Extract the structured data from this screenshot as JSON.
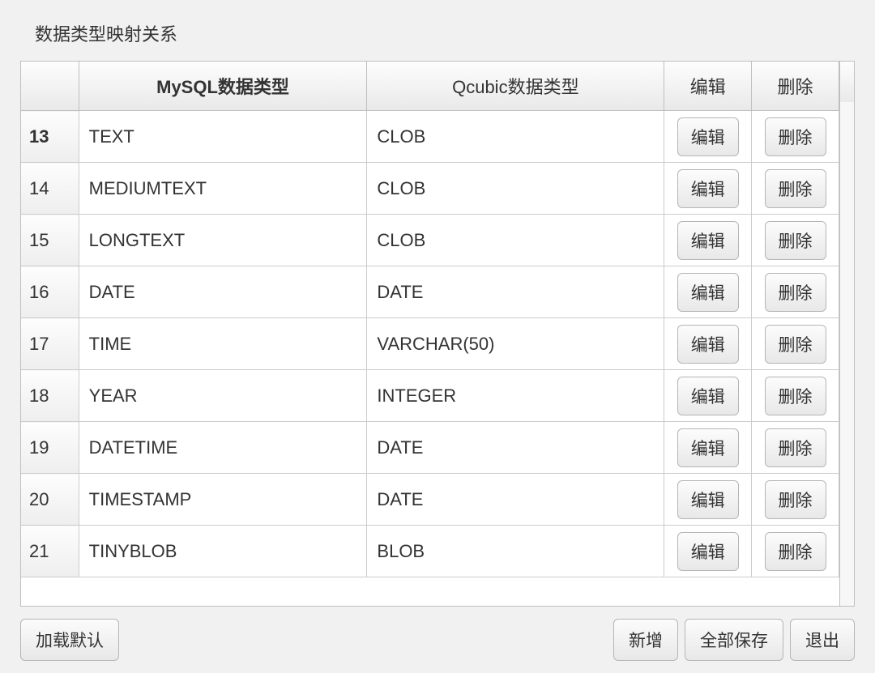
{
  "title": "数据类型映射关系",
  "columns": {
    "index": "",
    "mysql": "MySQL数据类型",
    "qcubic": "Qcubic数据类型",
    "edit": "编辑",
    "delete": "删除"
  },
  "actions": {
    "edit": "编辑",
    "delete": "删除"
  },
  "rows": [
    {
      "n": "13",
      "mysql": "TEXT",
      "qcubic": "CLOB",
      "selected": true
    },
    {
      "n": "14",
      "mysql": "MEDIUMTEXT",
      "qcubic": "CLOB",
      "selected": false
    },
    {
      "n": "15",
      "mysql": "LONGTEXT",
      "qcubic": "CLOB",
      "selected": false
    },
    {
      "n": "16",
      "mysql": "DATE",
      "qcubic": "DATE",
      "selected": false
    },
    {
      "n": "17",
      "mysql": "TIME",
      "qcubic": "VARCHAR(50)",
      "selected": false
    },
    {
      "n": "18",
      "mysql": "YEAR",
      "qcubic": "INTEGER",
      "selected": false
    },
    {
      "n": "19",
      "mysql": "DATETIME",
      "qcubic": "DATE",
      "selected": false
    },
    {
      "n": "20",
      "mysql": "TIMESTAMP",
      "qcubic": "DATE",
      "selected": false
    },
    {
      "n": "21",
      "mysql": "TINYBLOB",
      "qcubic": "BLOB",
      "selected": false
    }
  ],
  "footer": {
    "load_default": "加载默认",
    "add": "新增",
    "save_all": "全部保存",
    "exit": "退出"
  }
}
